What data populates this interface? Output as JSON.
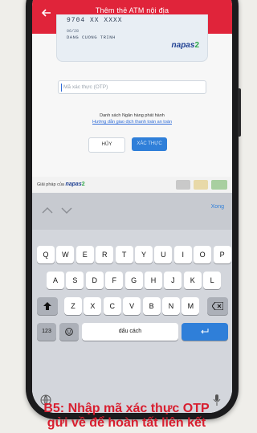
{
  "header": {
    "title": "Thêm thẻ ATM nội địa"
  },
  "card": {
    "number": "9704   XX XXXX",
    "expiry": "06/28",
    "holder": "DANG CUONG TRINH",
    "logo_text": "napas",
    "logo_mark": "2"
  },
  "otp": {
    "placeholder": "Mã xác thực (OTP)"
  },
  "links": {
    "bank_list": "Danh sách Ngân hàng phát hành",
    "guide": "Hướng dẫn giao dịch thanh toán an toàn"
  },
  "buttons": {
    "cancel": "HỦY",
    "confirm": "XÁC THỰC"
  },
  "footer": {
    "prefix": "Giải pháp của",
    "brand": "napas",
    "brand_mark": "2"
  },
  "keyboard": {
    "done": "Xong",
    "row1": [
      "Q",
      "W",
      "E",
      "R",
      "T",
      "Y",
      "U",
      "I",
      "O",
      "P"
    ],
    "row2": [
      "A",
      "S",
      "D",
      "F",
      "G",
      "H",
      "J",
      "K",
      "L"
    ],
    "row3": [
      "Z",
      "X",
      "C",
      "V",
      "B",
      "N",
      "M"
    ],
    "numbers_key": "123",
    "space_key": "dấu cách"
  },
  "caption": {
    "line1": "B5: Nhập mã xác thực OTP",
    "line2": "gửi về để hoàn tất liên kết"
  },
  "colors": {
    "header": "#e0243a",
    "accent": "#2f7fd9",
    "caption": "#d81e2f"
  }
}
